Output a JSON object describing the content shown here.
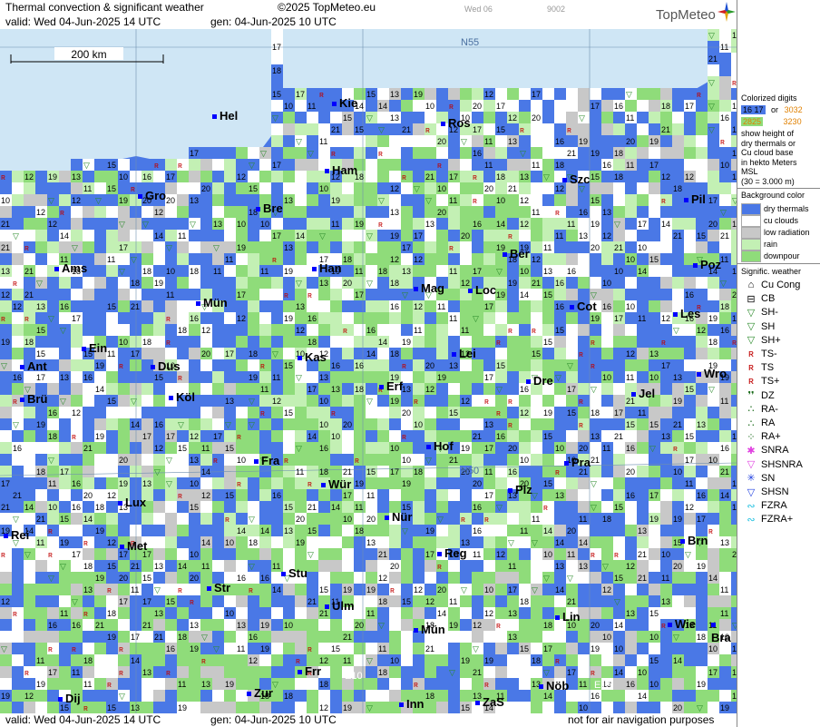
{
  "header": {
    "title": "Thermal convection & significant weather",
    "copyright": "©2025 TopMeteo.eu",
    "valid": "valid:  Wed  04-Jun-2025  14 UTC",
    "gen": "gen: 04-Jun-2025 10 UTC",
    "faint_day": "Wed 06",
    "faint_code": "9002",
    "brand": "TopMeteo"
  },
  "footer": {
    "valid": "valid:  Wed  04-Jun-2025  14 UTC",
    "gen": "gen: 04-Jun-2025 10 UTC",
    "note": "not for air navigation purposes"
  },
  "scale_bar": "200 km",
  "grid_labels": {
    "n55": "N55",
    "n50": "N50",
    "e15": "E15",
    "e10": "E10"
  },
  "cities": [
    {
      "name": "Hel"
    },
    {
      "name": "Kie"
    },
    {
      "name": "Ros"
    },
    {
      "name": "Ham"
    },
    {
      "name": "Szc"
    },
    {
      "name": "Gro"
    },
    {
      "name": "Bre"
    },
    {
      "name": "Pil"
    },
    {
      "name": "Ber"
    },
    {
      "name": "Ams"
    },
    {
      "name": "Han"
    },
    {
      "name": "Poz"
    },
    {
      "name": "Mün"
    },
    {
      "name": "Mag"
    },
    {
      "name": "Loc"
    },
    {
      "name": "Cot"
    },
    {
      "name": "Les"
    },
    {
      "name": "Ein"
    },
    {
      "name": "Kas"
    },
    {
      "name": "Lei"
    },
    {
      "name": "Ant"
    },
    {
      "name": "Dus"
    },
    {
      "name": "Dre"
    },
    {
      "name": "Wro"
    },
    {
      "name": "Brü"
    },
    {
      "name": "Köl"
    },
    {
      "name": "Erf"
    },
    {
      "name": "Jel"
    },
    {
      "name": "Hof"
    },
    {
      "name": "Fra"
    },
    {
      "name": "Pra"
    },
    {
      "name": "Wür"
    },
    {
      "name": "Lux"
    },
    {
      "name": "Plz"
    },
    {
      "name": "Nür"
    },
    {
      "name": "Rei"
    },
    {
      "name": "Met"
    },
    {
      "name": "Brn"
    },
    {
      "name": "Reg"
    },
    {
      "name": "Stu"
    },
    {
      "name": "Str"
    },
    {
      "name": "Ulm"
    },
    {
      "name": "Lin"
    },
    {
      "name": "Mün"
    },
    {
      "name": "Wie"
    },
    {
      "name": "Bra"
    },
    {
      "name": "Frr"
    },
    {
      "name": "Nöb"
    },
    {
      "name": "Dij"
    },
    {
      "name": "Zur"
    },
    {
      "name": "Inn"
    },
    {
      "name": "ZaS"
    }
  ],
  "legend": {
    "digits_title": "Colorized digits",
    "digits_sample_a": "16 17",
    "digits_sample_b": "3032",
    "digits_or": "or",
    "digits_sample_c": "2825",
    "digits_sample_d": "3230",
    "digits_desc": [
      "show height of",
      "dry thermals or",
      "Cu cloud base",
      "in hekto Meters",
      "MSL",
      "(30 = 3.000 m)"
    ],
    "bg_title": "Background color",
    "bg_items": [
      {
        "label": "dry thermals",
        "color": "#4a78e6"
      },
      {
        "label": "cu clouds",
        "color": "#ffffff"
      },
      {
        "label": "low radiation",
        "color": "#c8c8c8"
      },
      {
        "label": "rain",
        "color": "#c3f0b4"
      },
      {
        "label": "downpour",
        "color": "#8fdc7a"
      }
    ],
    "wx_title": "Signific. weather",
    "wx_items": [
      {
        "label": "Cu Cong",
        "icon": "cu-cong-icon",
        "glyph": "⌂",
        "color": "#000"
      },
      {
        "label": "CB",
        "icon": "cb-icon",
        "glyph": "⊟",
        "color": "#000"
      },
      {
        "label": "SH-",
        "icon": "shower-light-icon",
        "glyph": "▽",
        "color": "#2a8a2a"
      },
      {
        "label": "SH",
        "icon": "shower-icon",
        "glyph": "▽",
        "color": "#2a8a2a"
      },
      {
        "label": "SH+",
        "icon": "shower-heavy-icon",
        "glyph": "▽",
        "color": "#2a8a2a"
      },
      {
        "label": "TS-",
        "icon": "thunderstorm-light-icon",
        "glyph": "ʀ",
        "color": "#c00000"
      },
      {
        "label": "TS",
        "icon": "thunderstorm-icon",
        "glyph": "ʀ",
        "color": "#c00000"
      },
      {
        "label": "TS+",
        "icon": "thunderstorm-heavy-icon",
        "glyph": "ʀ",
        "color": "#c00000"
      },
      {
        "label": "DZ",
        "icon": "drizzle-icon",
        "glyph": "❜❜",
        "color": "#1a6a1a"
      },
      {
        "label": "RA-",
        "icon": "rain-light-icon",
        "glyph": "∴",
        "color": "#1a6a1a"
      },
      {
        "label": "RA",
        "icon": "rain-icon",
        "glyph": "∴",
        "color": "#1a6a1a"
      },
      {
        "label": "RA+",
        "icon": "rain-heavy-icon",
        "glyph": "⁘",
        "color": "#1a6a1a"
      },
      {
        "label": "SNRA",
        "icon": "snow-rain-icon",
        "glyph": "✱",
        "color": "#e040e0"
      },
      {
        "label": "SHSNRA",
        "icon": "snow-rain-shower-icon",
        "glyph": "▽",
        "color": "#e040e0"
      },
      {
        "label": "SN",
        "icon": "snow-icon",
        "glyph": "✳",
        "color": "#2040e0"
      },
      {
        "label": "SHSN",
        "icon": "snow-shower-icon",
        "glyph": "▽",
        "color": "#2040e0"
      },
      {
        "label": "FZRA",
        "icon": "freezing-rain-icon",
        "glyph": "∾",
        "color": "#20c0e0"
      },
      {
        "label": "FZRA+",
        "icon": "freezing-rain-heavy-icon",
        "glyph": "∾",
        "color": "#20c0e0"
      }
    ]
  }
}
